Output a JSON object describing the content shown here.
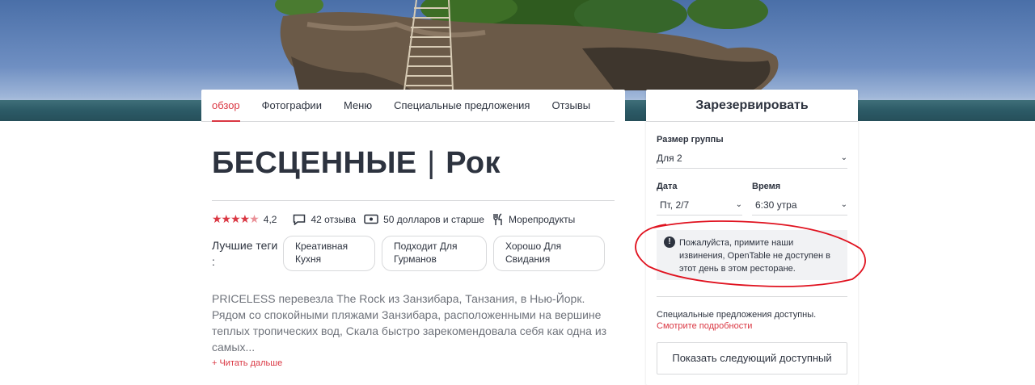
{
  "nav": {
    "tabs": [
      {
        "label": "обзор"
      },
      {
        "label": "Фотографии"
      },
      {
        "label": "Меню"
      },
      {
        "label": "Специальные предложения"
      },
      {
        "label": "Отзывы"
      }
    ]
  },
  "restaurant": {
    "name_part1": "БЕСЦЕННЫЕ",
    "separator": "|",
    "name_part2": "Рок",
    "rating": 4.2,
    "rating_text": "4,2",
    "reviews": "42 отзыва",
    "price": "50 долларов и старше",
    "cuisine": "Морепродукты",
    "tags_label": "Лучшие теги :",
    "tags": [
      "Креативная Кухня",
      "Подходит Для Гурманов",
      "Хорошо Для Свидания"
    ],
    "description": "PRICELESS перевезла The Rock из Занзибара, Танзания, в Нью-Йорк. Рядом со спокойными пляжами Занзибара, расположенными на вершине теплых тропических вод, Скала быстро зарекомендовала себя как одна из самых...",
    "read_more": "+ Читать дальше"
  },
  "reservation": {
    "title": "Зарезервировать",
    "party_label": "Размер группы",
    "party_value": "Для 2",
    "date_label": "Дата",
    "date_value": "Пт, 2/7",
    "time_label": "Время",
    "time_value": "6:30 утра",
    "alert": "Пожалуйста, примите наши извинения, OpenTable не доступен в этот день в этом ресторане.",
    "offers_text": "Специальные предложения доступны.",
    "offers_link": "Смотрите подробности",
    "next_button": "Показать следующий доступный"
  },
  "colors": {
    "accent": "#da3743",
    "text": "#2d333f",
    "annotation": "#e0121f"
  }
}
